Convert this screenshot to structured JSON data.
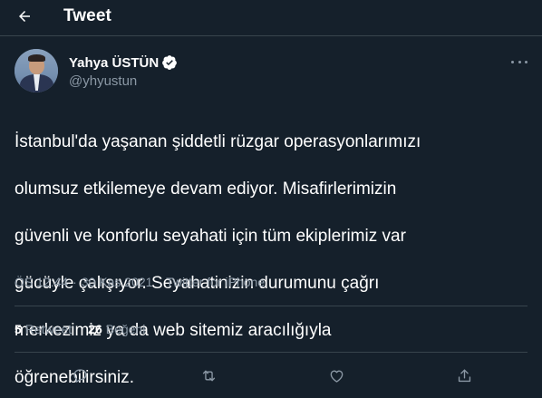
{
  "header": {
    "title": "Tweet"
  },
  "author": {
    "display_name": "Yahya ÜSTÜN",
    "handle": "@yhyustun",
    "verified": true
  },
  "tweet": {
    "text_lines": [
      "İstanbul'da yaşanan şiddetli rüzgar operasyonlarımızı",
      "olumsuz etkilemeye devam ediyor. Misafirlerimizin",
      "güvenli ve konforlu seyahati için tüm ekiplerimiz var",
      "gücüyle çalışıyor. Seyahatinizin durumunu çağrı",
      "merkezimiz ya da web sitemiz aracılığıyla",
      "öğrenebilirsiniz."
    ],
    "time": "ÖS 12:44",
    "separator": "·",
    "date": "30 Kas 2021",
    "source": "Twitter for iPhone"
  },
  "stats": {
    "retweets": {
      "count": "5",
      "label": "Retweet"
    },
    "likes": {
      "count": "26",
      "label": "Beğeni"
    }
  },
  "actions": [
    {
      "icon": "reply-icon"
    },
    {
      "icon": "retweet-icon"
    },
    {
      "icon": "like-icon"
    },
    {
      "icon": "share-icon"
    }
  ],
  "colors": {
    "background": "#15202b",
    "divider": "#38444d",
    "secondary_text": "#8b98a5",
    "verified": "#ffffff"
  }
}
